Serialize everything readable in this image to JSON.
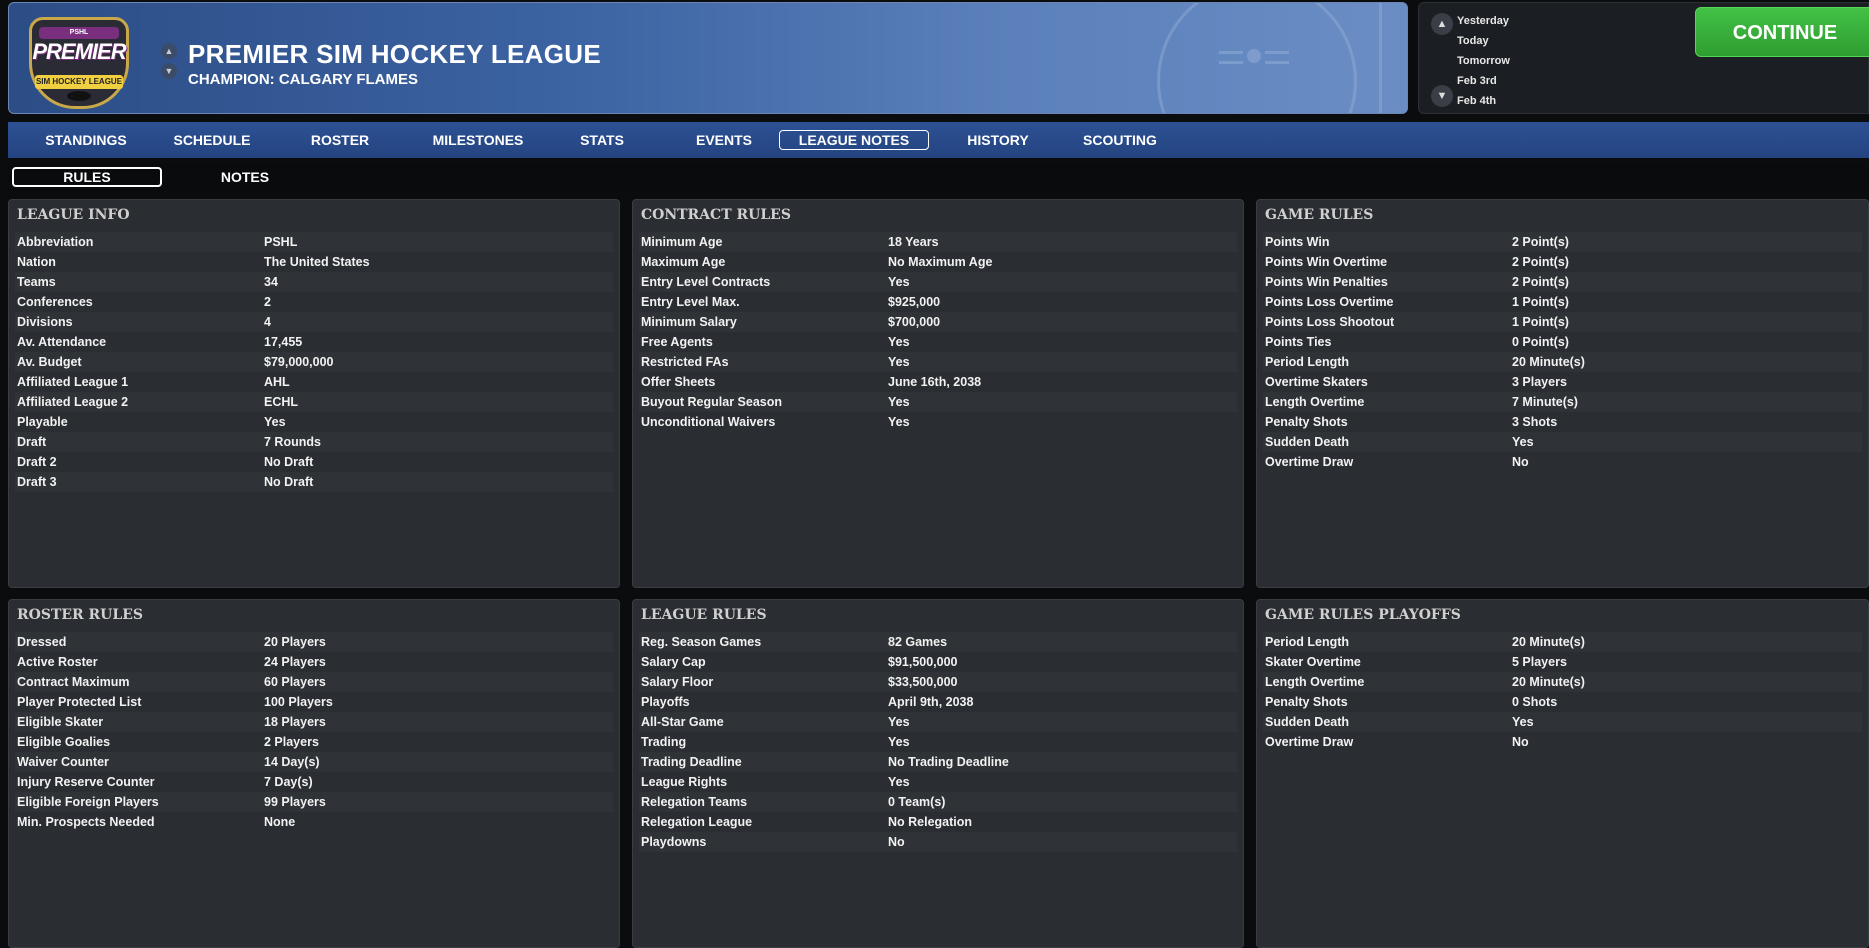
{
  "header": {
    "logo": {
      "top_text": "PSHL",
      "main_text": "PREMIER",
      "ribbon_text": "SIM HOCKEY LEAGUE"
    },
    "title": "PREMIER SIM HOCKEY LEAGUE",
    "champion": "CHAMPION: CALGARY FLAMES"
  },
  "date_panel": {
    "dates": [
      "Yesterday",
      "Today",
      "Tomorrow",
      "Feb 3rd",
      "Feb 4th"
    ],
    "continue_label": "CONTINUE"
  },
  "tabs": [
    {
      "label": "STANDINGS"
    },
    {
      "label": "SCHEDULE"
    },
    {
      "label": "ROSTER"
    },
    {
      "label": "MILESTONES"
    },
    {
      "label": "STATS"
    },
    {
      "label": "EVENTS"
    },
    {
      "label": "LEAGUE NOTES"
    },
    {
      "label": "HISTORY"
    },
    {
      "label": "SCOUTING"
    }
  ],
  "active_tab": "LEAGUE NOTES",
  "subtabs": [
    {
      "label": "RULES"
    },
    {
      "label": "NOTES"
    }
  ],
  "active_subtab": "RULES",
  "panels": {
    "league_info": {
      "title": "LEAGUE INFO",
      "rows": [
        {
          "k": "Abbreviation",
          "v": "PSHL"
        },
        {
          "k": "Nation",
          "v": "The United States"
        },
        {
          "k": "Teams",
          "v": "34"
        },
        {
          "k": "Conferences",
          "v": "2"
        },
        {
          "k": "Divisions",
          "v": "4"
        },
        {
          "k": "Av. Attendance",
          "v": "17,455"
        },
        {
          "k": "Av. Budget",
          "v": "$79,000,000"
        },
        {
          "k": "Affiliated League 1",
          "v": "AHL"
        },
        {
          "k": "Affiliated League 2",
          "v": "ECHL"
        },
        {
          "k": "Playable",
          "v": "Yes"
        },
        {
          "k": "Draft",
          "v": "7 Rounds"
        },
        {
          "k": "Draft 2",
          "v": "No Draft"
        },
        {
          "k": "Draft 3",
          "v": "No Draft"
        }
      ]
    },
    "contract_rules": {
      "title": "CONTRACT RULES",
      "rows": [
        {
          "k": "Minimum Age",
          "v": "18 Years"
        },
        {
          "k": "Maximum Age",
          "v": "No Maximum Age"
        },
        {
          "k": "Entry Level Contracts",
          "v": "Yes"
        },
        {
          "k": "Entry Level Max.",
          "v": "$925,000"
        },
        {
          "k": "Minimum Salary",
          "v": "$700,000"
        },
        {
          "k": "Free Agents",
          "v": "Yes"
        },
        {
          "k": "Restricted FAs",
          "v": "Yes"
        },
        {
          "k": "Offer Sheets",
          "v": "June 16th, 2038"
        },
        {
          "k": "Buyout Regular Season",
          "v": "Yes"
        },
        {
          "k": "Unconditional Waivers",
          "v": "Yes"
        }
      ]
    },
    "game_rules": {
      "title": "GAME RULES",
      "rows": [
        {
          "k": "Points Win",
          "v": "2 Point(s)"
        },
        {
          "k": "Points Win Overtime",
          "v": "2 Point(s)"
        },
        {
          "k": "Points Win Penalties",
          "v": "2 Point(s)"
        },
        {
          "k": "Points Loss Overtime",
          "v": "1 Point(s)"
        },
        {
          "k": "Points Loss Shootout",
          "v": "1 Point(s)"
        },
        {
          "k": "Points Ties",
          "v": "0 Point(s)"
        },
        {
          "k": "Period Length",
          "v": "20 Minute(s)"
        },
        {
          "k": "Overtime Skaters",
          "v": "3 Players"
        },
        {
          "k": "Length Overtime",
          "v": "7 Minute(s)"
        },
        {
          "k": "Penalty Shots",
          "v": "3 Shots"
        },
        {
          "k": "Sudden Death",
          "v": "Yes"
        },
        {
          "k": "Overtime Draw",
          "v": "No"
        }
      ]
    },
    "roster_rules": {
      "title": "ROSTER RULES",
      "rows": [
        {
          "k": "Dressed",
          "v": "20 Players"
        },
        {
          "k": "Active Roster",
          "v": "24 Players"
        },
        {
          "k": "Contract Maximum",
          "v": "60 Players"
        },
        {
          "k": "Player Protected List",
          "v": "100 Players"
        },
        {
          "k": "Eligible Skater",
          "v": "18 Players"
        },
        {
          "k": "Eligible Goalies",
          "v": "2 Players"
        },
        {
          "k": "Waiver Counter",
          "v": "14 Day(s)"
        },
        {
          "k": "Injury Reserve Counter",
          "v": "7 Day(s)"
        },
        {
          "k": "Eligible Foreign Players",
          "v": "99 Players"
        },
        {
          "k": "Min. Prospects Needed",
          "v": "None"
        }
      ]
    },
    "league_rules": {
      "title": "LEAGUE RULES",
      "rows": [
        {
          "k": "Reg. Season Games",
          "v": "82 Games"
        },
        {
          "k": "Salary Cap",
          "v": "$91,500,000"
        },
        {
          "k": "Salary Floor",
          "v": "$33,500,000"
        },
        {
          "k": "Playoffs",
          "v": "April 9th, 2038"
        },
        {
          "k": "All-Star Game",
          "v": "Yes"
        },
        {
          "k": "Trading",
          "v": "Yes"
        },
        {
          "k": "Trading Deadline",
          "v": "No Trading Deadline"
        },
        {
          "k": "League Rights",
          "v": "Yes"
        },
        {
          "k": "Relegation Teams",
          "v": "0 Team(s)"
        },
        {
          "k": "Relegation League",
          "v": "No Relegation"
        },
        {
          "k": "Playdowns",
          "v": "No"
        }
      ]
    },
    "game_rules_playoffs": {
      "title": "GAME RULES PLAYOFFS",
      "rows": [
        {
          "k": "Period Length",
          "v": "20 Minute(s)"
        },
        {
          "k": "Skater Overtime",
          "v": "5 Players"
        },
        {
          "k": "Length Overtime",
          "v": "20 Minute(s)"
        },
        {
          "k": "Penalty Shots",
          "v": "0 Shots"
        },
        {
          "k": "Sudden Death",
          "v": "Yes"
        },
        {
          "k": "Overtime Draw",
          "v": "No"
        }
      ]
    }
  }
}
